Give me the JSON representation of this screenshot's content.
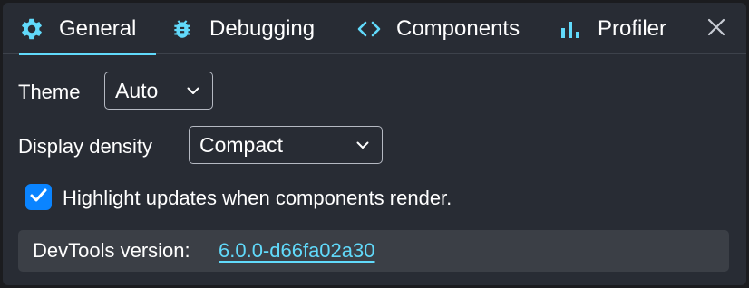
{
  "tabs": [
    {
      "label": "General",
      "icon": "gear-icon",
      "selected": true
    },
    {
      "label": "Debugging",
      "icon": "bug-icon",
      "selected": false
    },
    {
      "label": "Components",
      "icon": "code-brackets-icon",
      "selected": false
    },
    {
      "label": "Profiler",
      "icon": "bar-chart-icon",
      "selected": false
    }
  ],
  "close_icon": "close-icon",
  "settings": {
    "theme_label": "Theme",
    "theme_value": "Auto",
    "density_label": "Display density",
    "density_value": "Compact",
    "highlight_label": "Highlight updates when components render.",
    "highlight_checked": true
  },
  "version": {
    "label": "DevTools version:",
    "value": "6.0.0-d66fa02a30"
  },
  "colors": {
    "accent": "#61dafb",
    "background": "#282c34",
    "checkbox": "#0a84ff",
    "version_box": "#3b3f46"
  }
}
